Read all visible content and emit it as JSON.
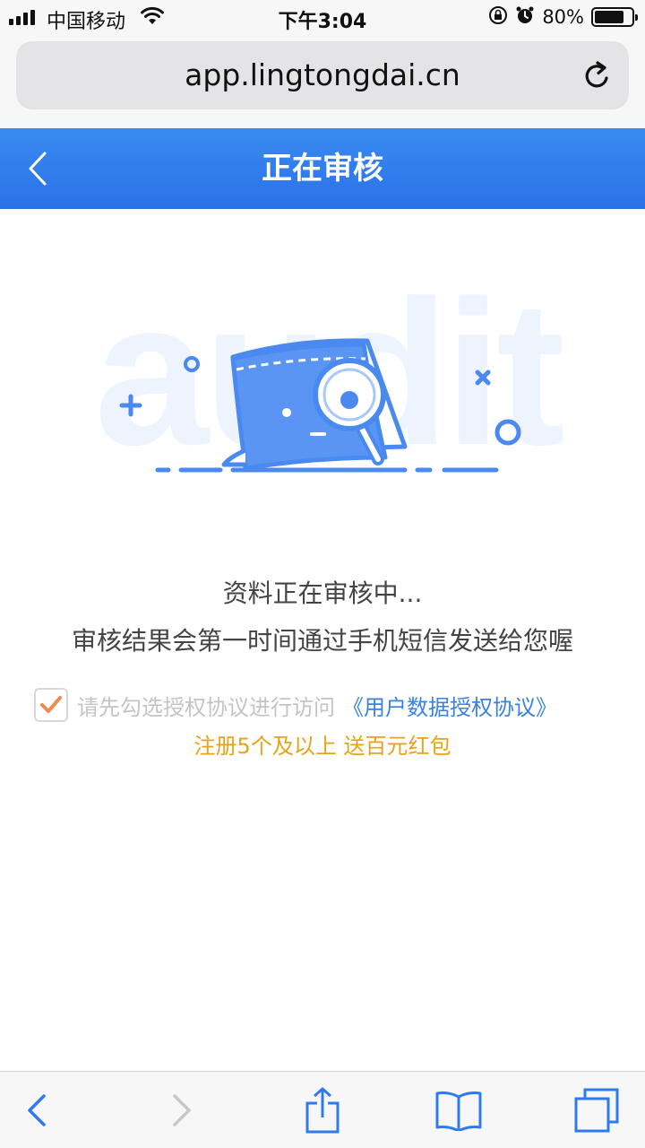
{
  "status_bar": {
    "carrier": "中国移动",
    "time": "下午3:04",
    "battery_percent": "80%",
    "battery_level": 0.8,
    "icons": [
      "signal-icon",
      "wifi-icon",
      "orientation-lock-icon",
      "alarm-icon",
      "battery-icon"
    ]
  },
  "browser": {
    "url": "app.lingtongdai.cn",
    "reload_icon": "reload-icon"
  },
  "navbar": {
    "title": "正在审核",
    "back_icon": "chevron-left-icon",
    "color": "#2f7bec"
  },
  "illustration": {
    "watermark_text": "audit",
    "icon": "document-magnifier-icon"
  },
  "content": {
    "message_line1": "资料正在审核中...",
    "message_line2": "审核结果会第一时间通过手机短信发送给您喔",
    "agreement_text": "请先勾选授权协议进行访问",
    "agreement_link": "《用户数据授权协议》",
    "agreement_checked": true,
    "promo": "注册5个及以上 送百元红包"
  },
  "toolbar": {
    "icons": [
      "back-icon",
      "forward-icon",
      "share-icon",
      "bookmarks-icon",
      "tabs-icon"
    ]
  },
  "colors": {
    "primary": "#2f7bec",
    "link": "#3a82e0",
    "promo": "#e8a317",
    "check": "#f0894e"
  }
}
